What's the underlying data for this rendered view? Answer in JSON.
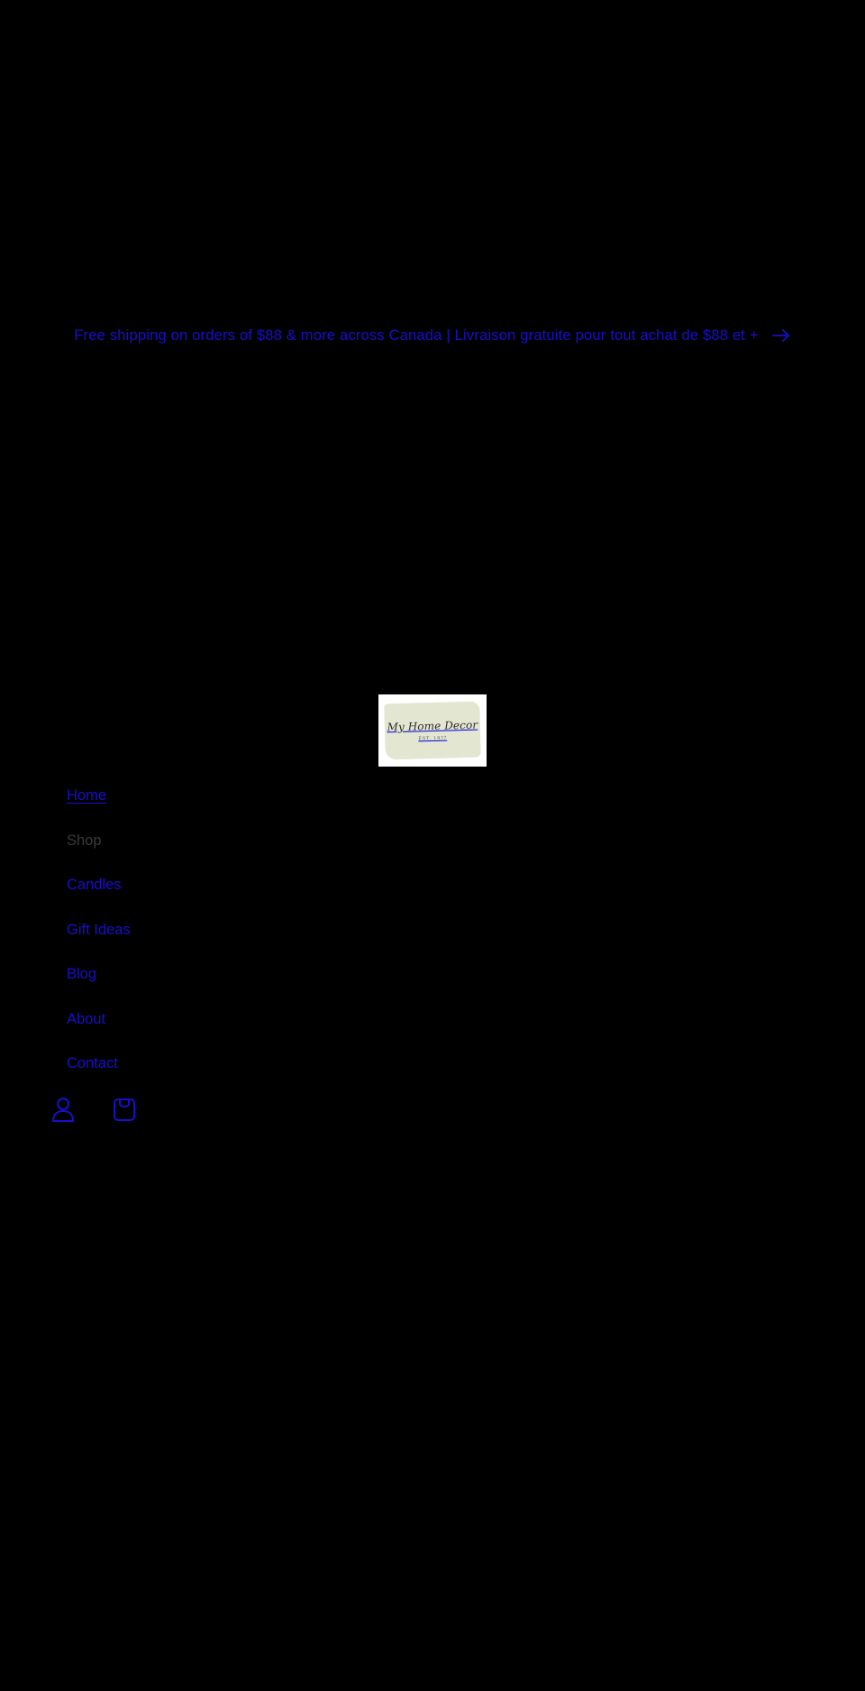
{
  "announcement": {
    "text": "Free shipping on orders of $88 & more across Canada | Livraison gratuite pour tout achat de $88 et +",
    "icon": "arrow-right-icon"
  },
  "header": {
    "logo": {
      "script_text": "My Home Decor",
      "est_text": "EST. 19??"
    }
  },
  "nav": {
    "items": [
      {
        "label": "Home"
      },
      {
        "label": "Shop"
      },
      {
        "label": "Candles"
      },
      {
        "label": "Gift Ideas"
      },
      {
        "label": "Blog"
      },
      {
        "label": "About"
      },
      {
        "label": "Contact"
      }
    ]
  },
  "header_icons": [
    {
      "icon": "account-icon"
    },
    {
      "icon": "cart-icon"
    }
  ],
  "colors": {
    "background": "#000000",
    "link": "#1a0dcc",
    "muted_link": "#3a3a3a",
    "logo_bg": "#ffffff",
    "logo_paint": "#e3e6d1"
  }
}
